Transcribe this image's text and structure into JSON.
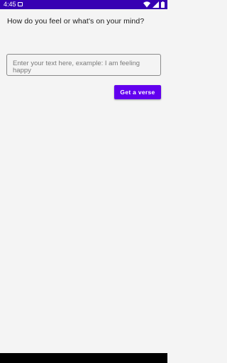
{
  "status_bar": {
    "time": "4:45",
    "icons": [
      "notification-icon",
      "wifi-icon",
      "signal-icon",
      "battery-icon"
    ],
    "color": "#3700b3"
  },
  "main": {
    "prompt": "How do you feel or what's on your mind?",
    "input": {
      "value": "",
      "placeholder": "Enter your text here, example: I am feeling happy"
    },
    "button_label": "Get a verse",
    "accent_color": "#6200ee"
  }
}
